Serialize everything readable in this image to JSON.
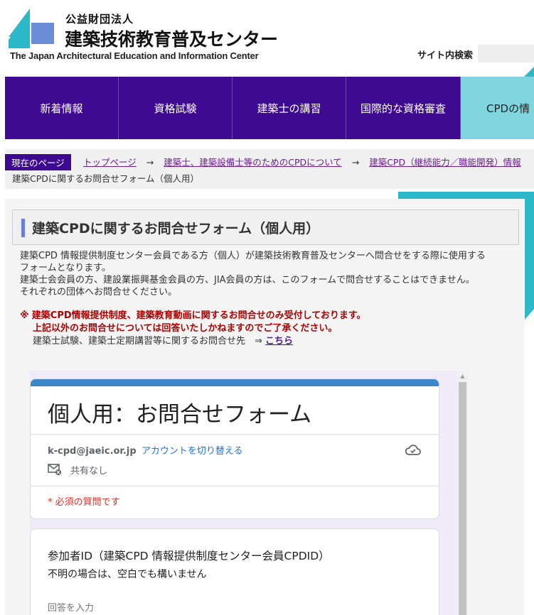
{
  "header": {
    "org_sub": "公益財団法人",
    "org_name": "建築技術教育普及センター",
    "org_en": "The Japan Architectural Education and Information Center",
    "search_label": "サイト内検索"
  },
  "nav": {
    "items": [
      {
        "label": "新着情報"
      },
      {
        "label": "資格試験"
      },
      {
        "label": "建築士の講習"
      },
      {
        "label": "国際的な資格審査"
      },
      {
        "label": "CPDの情"
      }
    ]
  },
  "breadcrumb": {
    "label": "現在のページ",
    "links": [
      "トップページ",
      "建築士、建築設備士等のためのCPDについて",
      "建築CPD（継続能力／職能開発）情報"
    ],
    "arrow": "→",
    "current": "建築CPDに関するお問合せフォーム（個人用）"
  },
  "page": {
    "title": "建築CPDに関するお問合せフォーム（個人用）",
    "desc": [
      "建築CPD 情報提供制度センター会員である方（個人）が建築技術教育普及センターへ問合せをする際に使用する",
      "フォームとなります。",
      "建築士会会員の方、建設業振興基金会員の方、JIA会員の方は、このフォームで問合せすることはできません。",
      "それぞれの団体へお問合せください。"
    ],
    "note_mark": "※",
    "note_red1": "建築CPD情報提供制度、建築教育動画に関するお問合せのみ受付しております。",
    "note_red2": "上記以外のお問合せについては回答いたしかねますのでご了承ください。",
    "note_plain": "建築士試験、建築士定期講習等に関するお問合せ先　⇒",
    "note_link": "こちら"
  },
  "form": {
    "title": "個人用：お問合せフォーム",
    "email": "k-cpd@jaeic.or.jp",
    "switch_account": "アカウントを切り替える",
    "share": "共有なし",
    "required": "* 必須の質問です",
    "question_title": "参加者ID（建築CPD 情報提供制度センター会員CPDID）",
    "question_help": "不明の場合は、空白でも構いません",
    "input_placeholder": "回答を入力"
  },
  "colors": {
    "nav_bg": "#3d0a91",
    "nav_active": "#7fd6df",
    "teal": "#2bb8c8",
    "form_accent": "#3b87c9",
    "note_red": "#b00000"
  }
}
